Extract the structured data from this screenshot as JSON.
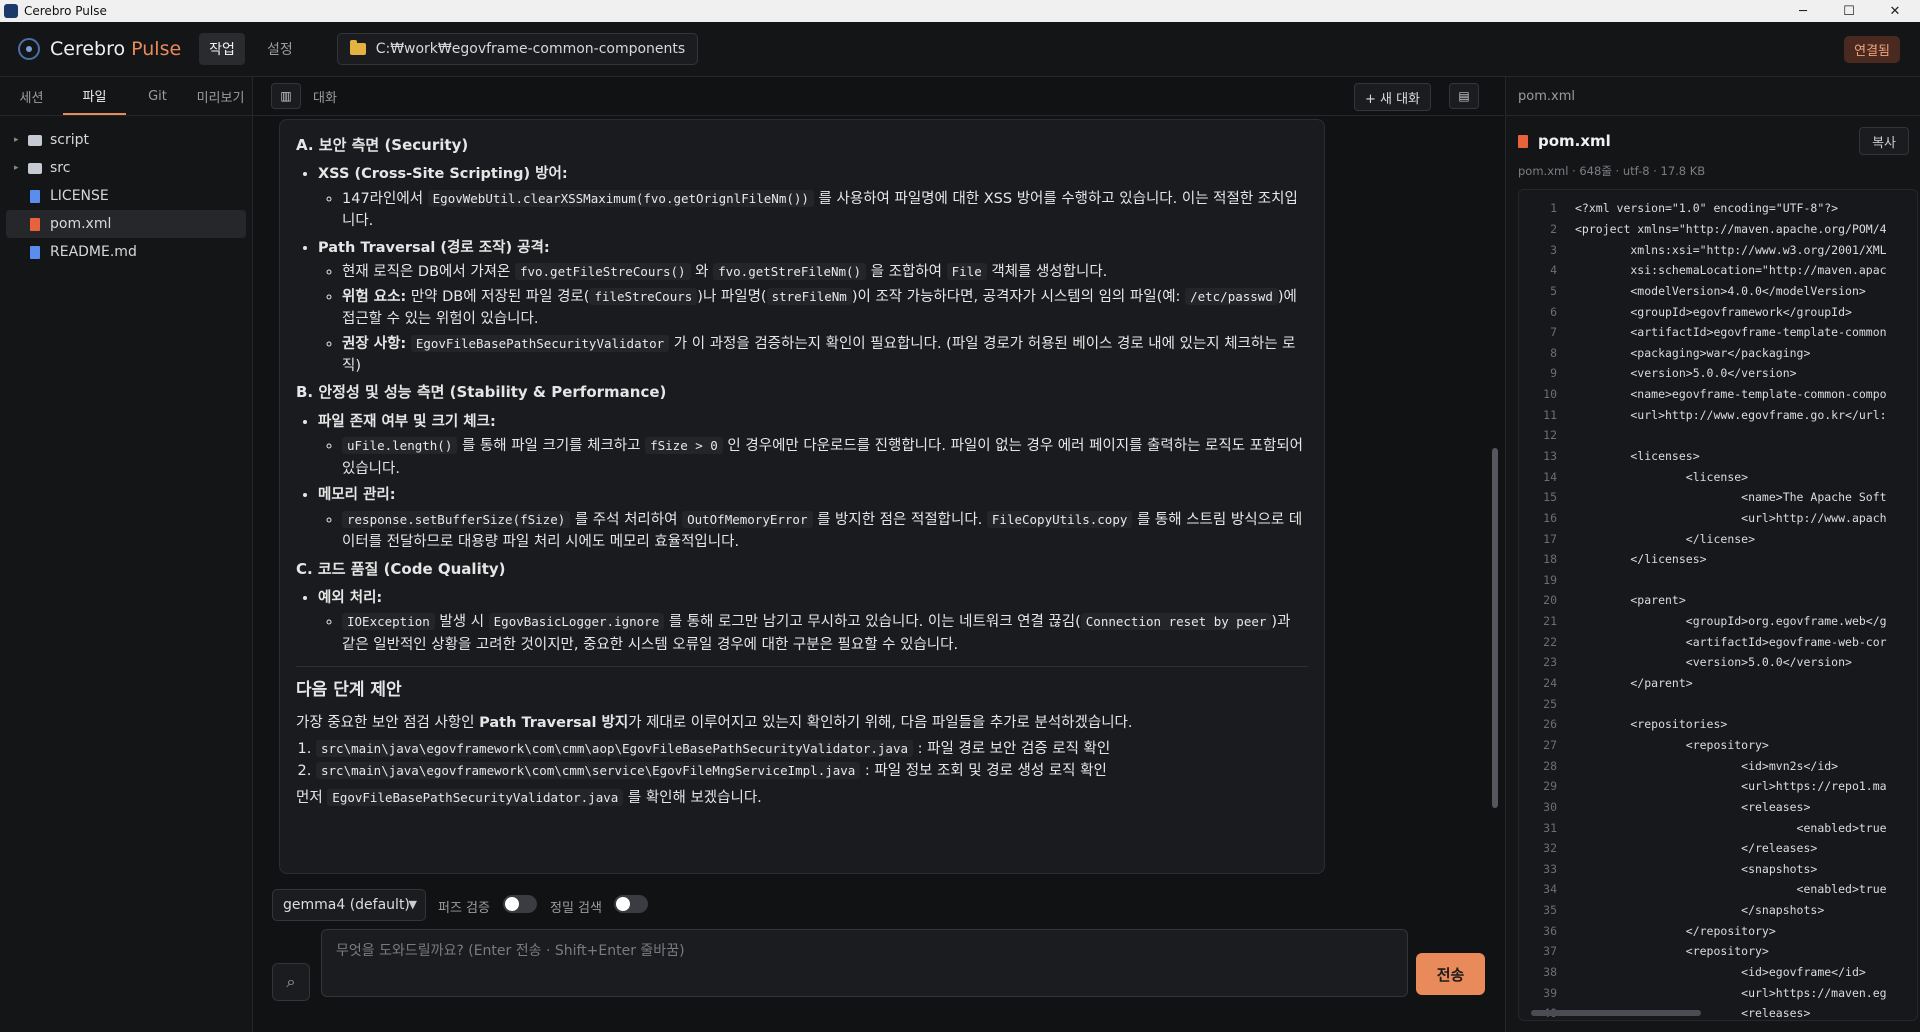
{
  "window": {
    "title": "Cerebro Pulse",
    "min": "─",
    "max": "☐",
    "close": "✕"
  },
  "header": {
    "brand_1": "Cerebro",
    "brand_2": "Pulse",
    "tabs": [
      "작업",
      "설정"
    ],
    "path": "C:₩work₩egovframe-common-components",
    "status": "연결됨"
  },
  "left": {
    "tabs": [
      "세션",
      "파일",
      "Git",
      "미리보기"
    ],
    "tree": [
      {
        "name": "script",
        "type": "folder"
      },
      {
        "name": "src",
        "type": "folder"
      },
      {
        "name": "LICENSE",
        "type": "file"
      },
      {
        "name": "pom.xml",
        "type": "xml"
      },
      {
        "name": "README.md",
        "type": "file"
      }
    ]
  },
  "chat": {
    "title": "대화",
    "new_chat": "+ 새 대화",
    "sections": {
      "a_title": "A. 보안 측면 (Security)",
      "a1_head": "XSS (Cross-Site Scripting) 방어:",
      "a1_s1_pre": "147라인에서 ",
      "a1_s1_code": "EgovWebUtil.clearXSSMaximum(fvo.getOrignlFileNm())",
      "a1_s1_post": " 를 사용하여 파일명에 대한 XSS 방어를 수행하고 있습니다. 이는 적절한 조치입니다.",
      "a2_head": "Path Traversal (경로 조작) 공격:",
      "a2_s1_pre": "현재 로직은 DB에서 가져온 ",
      "a2_s1_c1": "fvo.getFileStreCours()",
      "a2_s1_mid": " 와 ",
      "a2_s1_c2": "fvo.getStreFileNm()",
      "a2_s1_mid2": " 을 조합하여 ",
      "a2_s1_c3": "File",
      "a2_s1_post": " 객체를 생성합니다.",
      "a2_s2_bold": "위험 요소:",
      "a2_s2_pre": " 만약 DB에 저장된 파일 경로(",
      "a2_s2_c1": "fileStreCours",
      "a2_s2_mid": ")나 파일명(",
      "a2_s2_c2": "streFileNm",
      "a2_s2_mid2": ")이 조작 가능하다면, 공격자가 시스템의 임의 파일(예: ",
      "a2_s2_c3": "/etc/passwd",
      "a2_s2_post": ")에 접근할 수 있는 위험이 있습니다.",
      "a2_s3_bold": "권장 사항:",
      "a2_s3_c1": "EgovFileBasePathSecurityValidator",
      "a2_s3_post": " 가 이 과정을 검증하는지 확인이 필요합니다. (파일 경로가 허용된 베이스 경로 내에 있는지 체크하는 로직)",
      "b_title": "B. 안정성 및 성능 측면 (Stability & Performance)",
      "b1_head": "파일 존재 여부 및 크기 체크:",
      "b1_c1": "uFile.length()",
      "b1_mid": " 를 통해 파일 크기를 체크하고 ",
      "b1_c2": "fSize > 0",
      "b1_post": " 인 경우에만 다운로드를 진행합니다. 파일이 없는 경우 에러 페이지를 출력하는 로직도 포함되어 있습니다.",
      "b2_head": "메모리 관리:",
      "b2_c1": "response.setBufferSize(fSize)",
      "b2_mid": " 를 주석 처리하여 ",
      "b2_c2": "OutOfMemoryError",
      "b2_mid2": " 를 방지한 점은 적절합니다. ",
      "b2_c3": "FileCopyUtils.copy",
      "b2_post": " 를 통해 스트림 방식으로 데이터를 전달하므로 대용량 파일 처리 시에도 메모리 효율적입니다.",
      "c_title": "C. 코드 품질 (Code Quality)",
      "c1_head": "예외 처리:",
      "c1_c1": "IOException",
      "c1_mid": " 발생 시 ",
      "c1_c2": "EgovBasicLogger.ignore",
      "c1_mid2": " 를 통해 로그만 남기고 무시하고 있습니다. 이는 네트워크 연결 끊김(",
      "c1_c3": "Connection reset by peer",
      "c1_post": ")과 같은 일반적인 상황을 고려한 것이지만, 중요한 시스템 오류일 경우에 대한 구분은 필요할 수 있습니다.",
      "next_title": "다음 단계 제안",
      "next_pre": "가장 중요한 보안 점검 사항인 ",
      "next_bold": "Path Traversal 방지",
      "next_post": "가 제대로 이루어지고 있는지 확인하기 위해, 다음 파일들을 추가로 분석하겠습니다.",
      "step1_code": "src\\main\\java\\egovframework\\com\\cmm\\aop\\EgovFileBasePathSecurityValidator.java",
      "step1_text": " : 파일 경로 보안 검증 로직 확인",
      "step2_code": "src\\main\\java\\egovframework\\com\\cmm\\service\\EgovFileMngServiceImpl.java",
      "step2_text": " : 파일 정보 조회 및 경로 생성 로직 확인",
      "final_pre": "먼저 ",
      "final_code": "EgovFileBasePathSecurityValidator.java",
      "final_post": " 를 확인해 보겠습니다."
    },
    "model": "gemma4 (default)",
    "toggle_1": "퍼즈 검증",
    "toggle_2": "정밀 검색",
    "input_placeholder": "무엇을 도와드릴까요? (Enter 전송 · Shift+Enter 줄바꿈)",
    "send": "전송"
  },
  "right": {
    "tab": "pom.xml",
    "file_name": "pom.xml",
    "copy": "복사",
    "meta": "pom.xml · 648줄 · utf-8 · 17.8 KB",
    "lines": [
      {
        "n": "1",
        "t": "<?xml version=\"1.0\" encoding=\"UTF-8\"?>"
      },
      {
        "n": "2",
        "t": "<project xmlns=\"http://maven.apache.org/POM/4"
      },
      {
        "n": "3",
        "t": "        xmlns:xsi=\"http://www.w3.org/2001/XML"
      },
      {
        "n": "4",
        "t": "        xsi:schemaLocation=\"http://maven.apac"
      },
      {
        "n": "5",
        "t": "        <modelVersion>4.0.0</modelVersion>"
      },
      {
        "n": "6",
        "t": "        <groupId>egovframework</groupId>"
      },
      {
        "n": "7",
        "t": "        <artifactId>egovframe-template-common"
      },
      {
        "n": "8",
        "t": "        <packaging>war</packaging>"
      },
      {
        "n": "9",
        "t": "        <version>5.0.0</version>"
      },
      {
        "n": "10",
        "t": "        <name>egovframe-template-common-compo"
      },
      {
        "n": "11",
        "t": "        <url>http://www.egovframe.go.kr</url:"
      },
      {
        "n": "12",
        "t": ""
      },
      {
        "n": "13",
        "t": "        <licenses>"
      },
      {
        "n": "14",
        "t": "                <license>"
      },
      {
        "n": "15",
        "t": "                        <name>The Apache Soft"
      },
      {
        "n": "16",
        "t": "                        <url>http://www.apach"
      },
      {
        "n": "17",
        "t": "                </license>"
      },
      {
        "n": "18",
        "t": "        </licenses>"
      },
      {
        "n": "19",
        "t": ""
      },
      {
        "n": "20",
        "t": "        <parent>"
      },
      {
        "n": "21",
        "t": "                <groupId>org.egovframe.web</g"
      },
      {
        "n": "22",
        "t": "                <artifactId>egovframe-web-cor"
      },
      {
        "n": "23",
        "t": "                <version>5.0.0</version>"
      },
      {
        "n": "24",
        "t": "        </parent>"
      },
      {
        "n": "25",
        "t": ""
      },
      {
        "n": "26",
        "t": "        <repositories>"
      },
      {
        "n": "27",
        "t": "                <repository>"
      },
      {
        "n": "28",
        "t": "                        <id>mvn2s</id>"
      },
      {
        "n": "29",
        "t": "                        <url>https://repo1.ma"
      },
      {
        "n": "30",
        "t": "                        <releases>"
      },
      {
        "n": "31",
        "t": "                                <enabled>true"
      },
      {
        "n": "32",
        "t": "                        </releases>"
      },
      {
        "n": "33",
        "t": "                        <snapshots>"
      },
      {
        "n": "34",
        "t": "                                <enabled>true"
      },
      {
        "n": "35",
        "t": "                        </snapshots>"
      },
      {
        "n": "36",
        "t": "                </repository>"
      },
      {
        "n": "37",
        "t": "                <repository>"
      },
      {
        "n": "38",
        "t": "                        <id>egovframe</id>"
      },
      {
        "n": "39",
        "t": "                        <url>https://maven.eg"
      },
      {
        "n": "40",
        "t": "                        <releases>"
      }
    ]
  }
}
